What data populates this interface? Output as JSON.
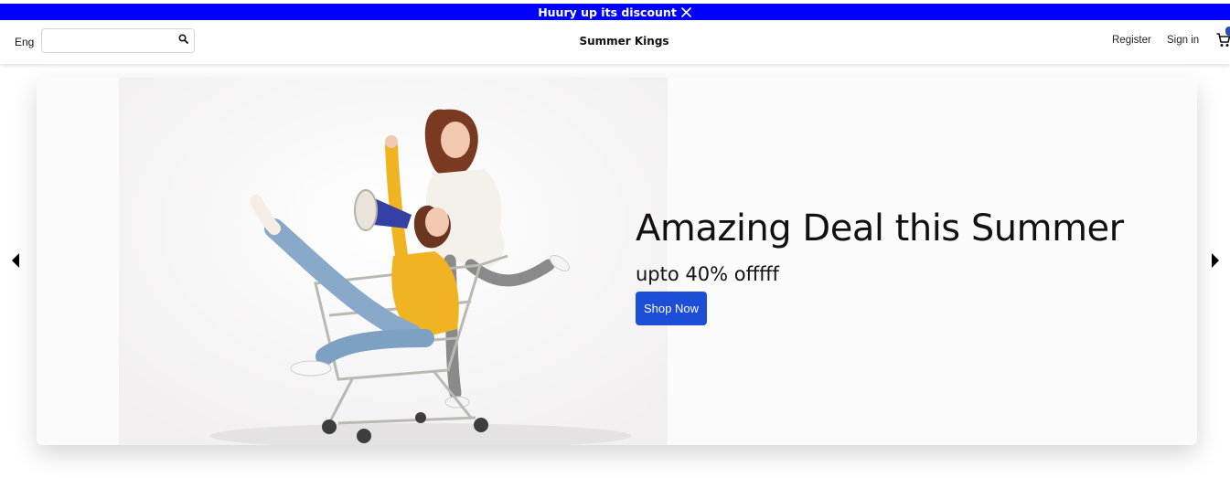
{
  "announcement": {
    "text": "Huury up its discount",
    "close_icon": "close-icon"
  },
  "navbar": {
    "language": "Eng",
    "search": {
      "value": "",
      "placeholder": "",
      "icon": "search-icon"
    },
    "brand": "Summer Kings",
    "register_label": "Register",
    "signin_label": "Sign in",
    "cart_icon": "cart-icon"
  },
  "hero": {
    "image_subject": "two-women-with-shopping-cart-and-megaphone",
    "headline": "Amazing Deal this Summer",
    "subheadline": "upto 40% offfff",
    "cta_label": "Shop Now",
    "prev_icon": "caret-left-icon",
    "next_icon": "caret-right-icon"
  },
  "colors": {
    "announcement_bg": "#0000ff",
    "cta_bg": "#1d4ed8",
    "hero_bg": "#fcfbfb",
    "cart_badge": "#2d4fb5"
  }
}
